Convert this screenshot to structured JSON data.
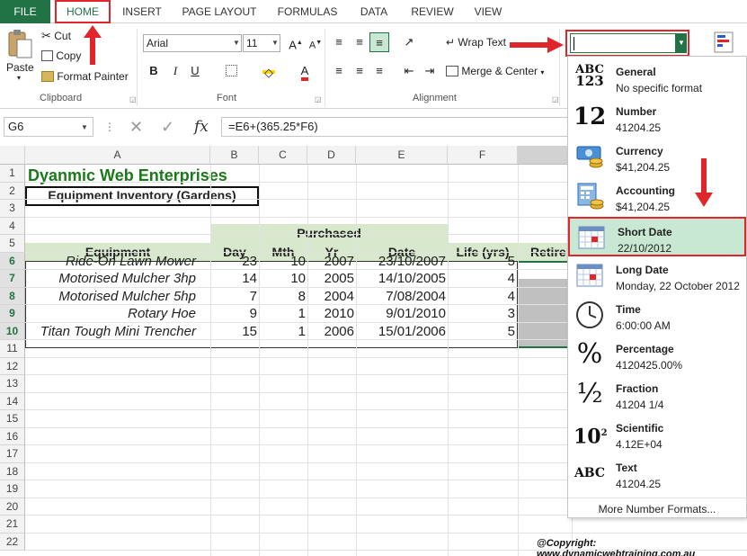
{
  "tabs": [
    "FILE",
    "HOME",
    "INSERT",
    "PAGE LAYOUT",
    "FORMULAS",
    "DATA",
    "REVIEW",
    "VIEW"
  ],
  "clipboard": {
    "paste": "Paste",
    "cut": "Cut",
    "copy": "Copy",
    "format_painter": "Format Painter",
    "label": "Clipboard"
  },
  "font": {
    "name": "Arial",
    "size": "11",
    "bold": "B",
    "italic": "I",
    "underline": "U",
    "label": "Font"
  },
  "alignment": {
    "wrap_text": "Wrap Text",
    "merge_center": "Merge & Center",
    "label": "Alignment"
  },
  "name_box": "G6",
  "formula": "=E6+(365.25*F6)",
  "columns": [
    "A",
    "B",
    "C",
    "D",
    "E",
    "F"
  ],
  "partial_column_g": "Retire",
  "rows": [
    "1",
    "2",
    "3",
    "4",
    "5",
    "6",
    "7",
    "8",
    "9",
    "10",
    "11",
    "12",
    "13",
    "14",
    "15",
    "16",
    "17",
    "18",
    "19",
    "20",
    "21",
    "22"
  ],
  "sheet": {
    "title": "Dyanmic Web Enterprises",
    "subtitle": "Equipment Inventory (Gardens)",
    "purchased": "Purchased",
    "headers": {
      "equipment": "Equipment",
      "day": "Day",
      "mth": "Mth",
      "yr": "Yr",
      "date": "Date",
      "life": "Life (yrs)"
    },
    "data": [
      {
        "equipment": "Ride-On Lawn Mower",
        "day": "23",
        "mth": "10",
        "yr": "2007",
        "date": "23/10/2007",
        "life": "5"
      },
      {
        "equipment": "Motorised Mulcher 3hp",
        "day": "14",
        "mth": "10",
        "yr": "2005",
        "date": "14/10/2005",
        "life": "4"
      },
      {
        "equipment": "Motorised Mulcher 5hp",
        "day": "7",
        "mth": "8",
        "yr": "2004",
        "date": "7/08/2004",
        "life": "4"
      },
      {
        "equipment": "Rotary Hoe",
        "day": "9",
        "mth": "1",
        "yr": "2010",
        "date": "9/01/2010",
        "life": "3"
      },
      {
        "equipment": "Titan Tough Mini Trencher",
        "day": "15",
        "mth": "1",
        "yr": "2006",
        "date": "15/01/2006",
        "life": "5"
      }
    ]
  },
  "number_formats": [
    {
      "name": "General",
      "sample": "No specific format",
      "icon": "general-icon",
      "glyph": "ABC 123"
    },
    {
      "name": "Number",
      "sample": "41204.25",
      "icon": "number-icon",
      "glyph": "12"
    },
    {
      "name": "Currency",
      "sample": "$41,204.25",
      "icon": "currency-icon"
    },
    {
      "name": "Accounting",
      "sample": "$41,204.25",
      "icon": "accounting-icon"
    },
    {
      "name": "Short Date",
      "sample": "22/10/2012",
      "icon": "calendar-icon"
    },
    {
      "name": "Long Date",
      "sample": "Monday, 22 October 2012",
      "icon": "calendar-icon"
    },
    {
      "name": "Time",
      "sample": "6:00:00 AM",
      "icon": "clock-icon"
    },
    {
      "name": "Percentage",
      "sample": "4120425.00%",
      "icon": "percent-icon",
      "glyph": "%"
    },
    {
      "name": "Fraction",
      "sample": "41204 1/4",
      "icon": "fraction-icon",
      "glyph": "½"
    },
    {
      "name": "Scientific",
      "sample": "4.12E+04",
      "icon": "scientific-icon",
      "glyph": "10",
      "sup": "2"
    },
    {
      "name": "Text",
      "sample": "41204.25",
      "icon": "text-icon",
      "glyph": "ABC"
    }
  ],
  "more_formats": "More Number Formats...",
  "copyright": "@Copyright: www.dynamicwebtraining.com.au",
  "colors": {
    "excel_green": "#217346",
    "highlight": "#c9e8d3",
    "annotation_red": "#e0252b",
    "title_green": "#1a7a1a"
  }
}
